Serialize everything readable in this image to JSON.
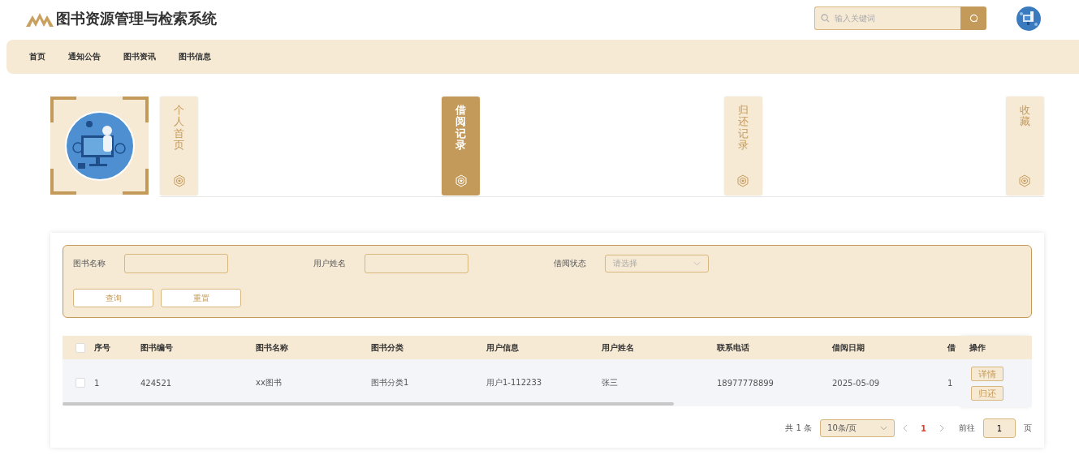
{
  "header": {
    "title": "图书资源管理与检索系统",
    "search": {
      "placeholder": "输入关键词"
    }
  },
  "nav": [
    {
      "label": "首页"
    },
    {
      "label": "通知公告"
    },
    {
      "label": "图书资讯"
    },
    {
      "label": "图书信息"
    }
  ],
  "profile_tabs": [
    {
      "label": "个人首页",
      "selected": false
    },
    {
      "label": "借阅记录",
      "selected": true
    },
    {
      "label": "归还记录",
      "selected": false
    },
    {
      "label": "收藏",
      "selected": false
    }
  ],
  "filters": [
    {
      "label": "图书名称",
      "kind": "input"
    },
    {
      "label": "用户姓名",
      "kind": "input"
    },
    {
      "label": "借阅状态",
      "kind": "select",
      "placeholder": "请选择"
    }
  ],
  "filter_buttons": [
    "查询",
    "重置"
  ],
  "table": {
    "all_checked": false,
    "columns": [
      "序号",
      "图书编号",
      "图书名称",
      "图书分类",
      "用户信息",
      "用户姓名",
      "联系电话",
      "借阅日期",
      "借"
    ],
    "action_column": "操作",
    "rows": [
      {
        "checked": false,
        "cells": [
          "1",
          "424521",
          "xx图书",
          "图书分类1",
          "用户1-112233",
          "张三",
          "18977778899",
          "2025-05-09",
          "1"
        ],
        "actions": [
          "详情",
          "归还"
        ]
      }
    ]
  },
  "pagination": {
    "total": "共 1 条",
    "page_size": "10条/页",
    "pages": [
      {
        "label": "1",
        "selected": true
      }
    ],
    "goto_label": "前往",
    "goto_value": "1",
    "goto_suffix": "页"
  }
}
